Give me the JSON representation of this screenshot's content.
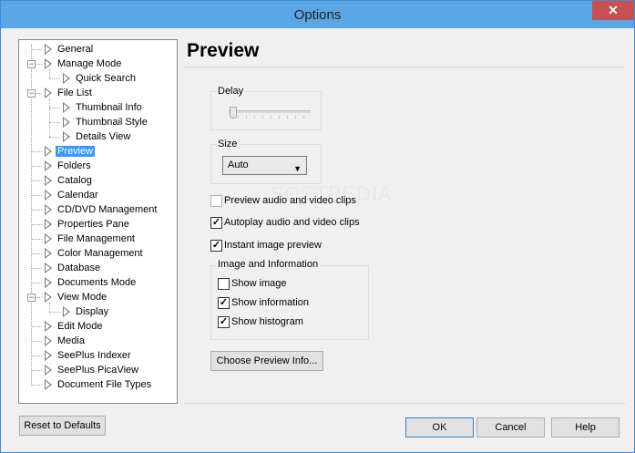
{
  "window": {
    "title": "Options",
    "close_glyph": "✕"
  },
  "tree": {
    "items": [
      {
        "label": "General",
        "level": 0,
        "expander": false
      },
      {
        "label": "Manage Mode",
        "level": 0,
        "expander": true
      },
      {
        "label": "Quick Search",
        "level": 1,
        "expander": false
      },
      {
        "label": "File List",
        "level": 0,
        "expander": true
      },
      {
        "label": "Thumbnail Info",
        "level": 1,
        "expander": false
      },
      {
        "label": "Thumbnail Style",
        "level": 1,
        "expander": false
      },
      {
        "label": "Details View",
        "level": 1,
        "expander": false
      },
      {
        "label": "Preview",
        "level": 0,
        "expander": false,
        "selected": true
      },
      {
        "label": "Folders",
        "level": 0,
        "expander": false
      },
      {
        "label": "Catalog",
        "level": 0,
        "expander": false
      },
      {
        "label": "Calendar",
        "level": 0,
        "expander": false
      },
      {
        "label": "CD/DVD Management",
        "level": 0,
        "expander": false
      },
      {
        "label": "Properties Pane",
        "level": 0,
        "expander": false
      },
      {
        "label": "File Management",
        "level": 0,
        "expander": false
      },
      {
        "label": "Color Management",
        "level": 0,
        "expander": false
      },
      {
        "label": "Database",
        "level": 0,
        "expander": false
      },
      {
        "label": "Documents Mode",
        "level": 0,
        "expander": false
      },
      {
        "label": "View Mode",
        "level": 0,
        "expander": true
      },
      {
        "label": "Display",
        "level": 1,
        "expander": false
      },
      {
        "label": "Edit Mode",
        "level": 0,
        "expander": false
      },
      {
        "label": "Media",
        "level": 0,
        "expander": false
      },
      {
        "label": "SeePlus Indexer",
        "level": 0,
        "expander": false
      },
      {
        "label": "SeePlus PicaView",
        "level": 0,
        "expander": false
      },
      {
        "label": "Document File Types",
        "level": 0,
        "expander": false
      }
    ]
  },
  "panel": {
    "title": "Preview",
    "delay": {
      "label": "Delay",
      "value": 0
    },
    "size": {
      "label": "Size",
      "selected": "Auto"
    },
    "checks": {
      "preview_av": {
        "label": "Preview audio and video clips",
        "checked": false
      },
      "autoplay_av": {
        "label": "Autoplay audio and video clips",
        "checked": true
      },
      "instant": {
        "label": "Instant image preview",
        "checked": true
      }
    },
    "image_info": {
      "label": "Image and Information",
      "show_image": {
        "label": "Show image",
        "checked": false
      },
      "show_information": {
        "label": "Show information",
        "checked": true
      },
      "show_histogram": {
        "label": "Show histogram",
        "checked": true
      }
    },
    "choose_button": "Choose Preview Info..."
  },
  "footer": {
    "reset": "Reset to Defaults",
    "ok": "OK",
    "cancel": "Cancel",
    "help": "Help"
  },
  "watermark": "SOFTPEDIA",
  "colors": {
    "titlebar": "#5ba7e6",
    "selection": "#3399ff",
    "close": "#c75050"
  }
}
